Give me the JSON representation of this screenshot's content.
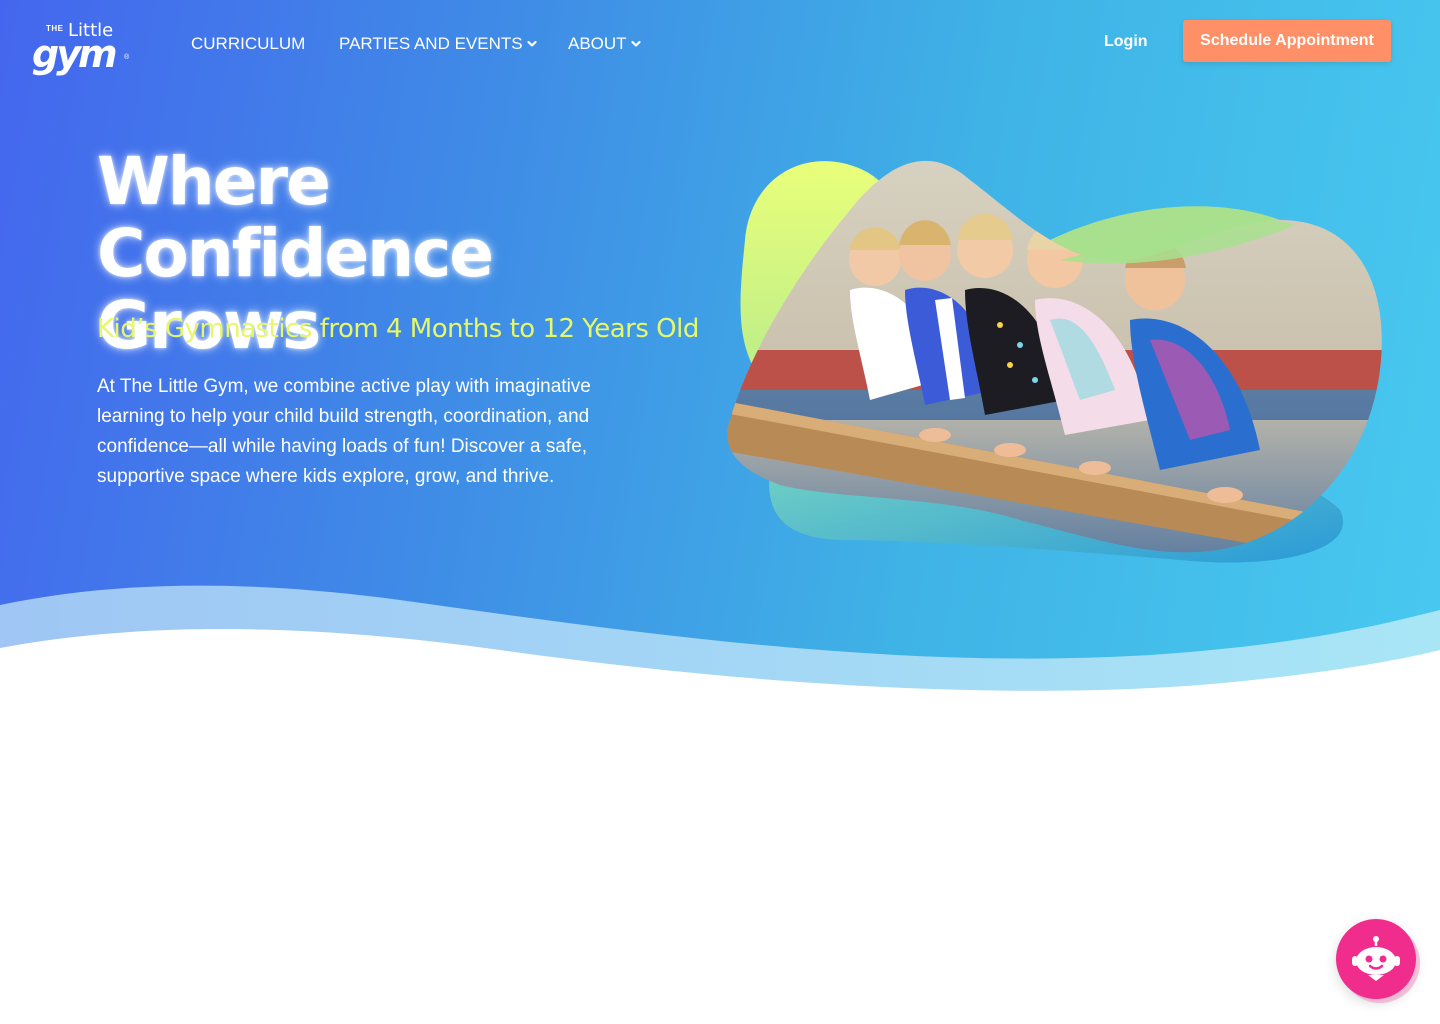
{
  "brand": {
    "logo_the": "THE",
    "logo_little": "Little",
    "logo_gym": "gym",
    "logo_reg": "®"
  },
  "nav": {
    "items": [
      {
        "label": "CURRICULUM",
        "has_dropdown": false
      },
      {
        "label": "PARTIES AND EVENTS",
        "has_dropdown": true
      },
      {
        "label": "ABOUT",
        "has_dropdown": true
      }
    ],
    "login_label": "Login",
    "cta_label": "Schedule Appointment"
  },
  "hero": {
    "title_line1": "Where Confidence",
    "title_line2": "Grows",
    "subtitle": "Kid’s Gymnastics from 4 Months to 12 Years Old",
    "body": "At The Little Gym, we combine active play with imaginative learning to help your child build strength, coordination, and confidence—all while having loads of fun! Discover a safe, supportive space where kids explore, grow, and thrive.",
    "image_icon": "gymnasts-photo"
  },
  "chatbot": {
    "icon": "robot-icon"
  },
  "colors": {
    "gradient_start": "#4466ee",
    "gradient_end": "#48c9f0",
    "cta": "#ff8f66",
    "subtitle": "#e6f76a",
    "chatbot": "#f02c8c"
  }
}
